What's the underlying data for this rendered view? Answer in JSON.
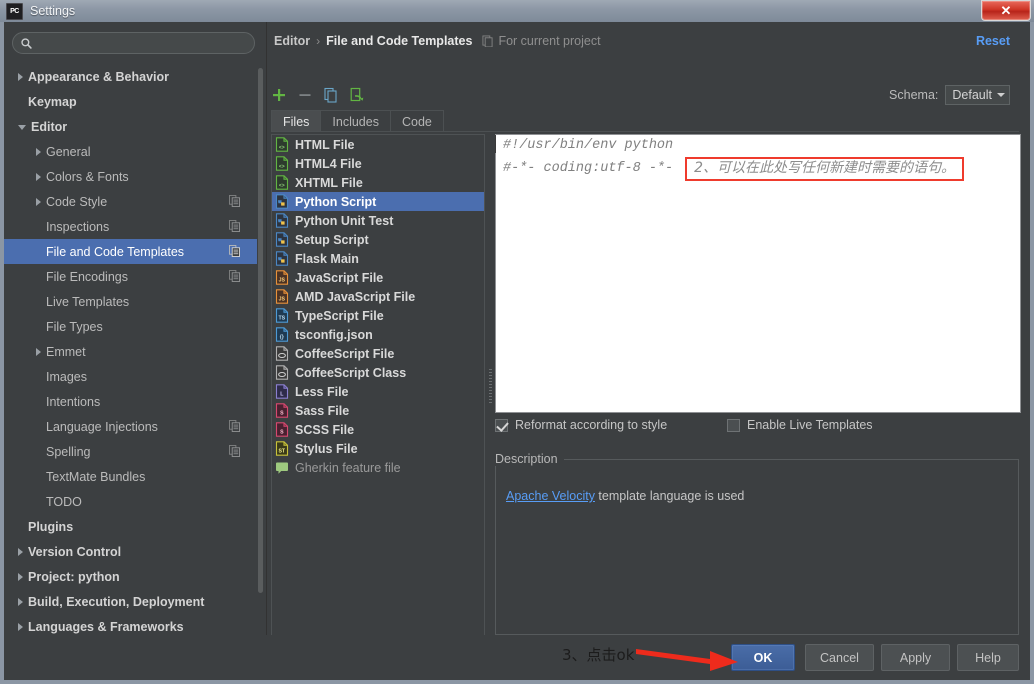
{
  "window": {
    "title": "Settings",
    "logo_text": "PC",
    "close_label": "✕"
  },
  "sidebar": {
    "search_placeholder": "",
    "search_value": "",
    "items": [
      {
        "label": "Appearance & Behavior",
        "level": 0,
        "arrow": "right",
        "bold": true,
        "selected": false,
        "badge": false
      },
      {
        "label": "Keymap",
        "level": 0,
        "arrow": "none",
        "bold": true,
        "selected": false,
        "badge": false
      },
      {
        "label": "Editor",
        "level": 0,
        "arrow": "down",
        "bold": true,
        "selected": false,
        "badge": false
      },
      {
        "label": "General",
        "level": 1,
        "arrow": "right",
        "bold": false,
        "selected": false,
        "badge": false
      },
      {
        "label": "Colors & Fonts",
        "level": 1,
        "arrow": "right",
        "bold": false,
        "selected": false,
        "badge": false
      },
      {
        "label": "Code Style",
        "level": 1,
        "arrow": "right",
        "bold": false,
        "selected": false,
        "badge": true
      },
      {
        "label": "Inspections",
        "level": 1,
        "arrow": "none",
        "bold": false,
        "selected": false,
        "badge": true
      },
      {
        "label": "File and Code Templates",
        "level": 1,
        "arrow": "none",
        "bold": false,
        "selected": true,
        "badge": true
      },
      {
        "label": "File Encodings",
        "level": 1,
        "arrow": "none",
        "bold": false,
        "selected": false,
        "badge": true
      },
      {
        "label": "Live Templates",
        "level": 1,
        "arrow": "none",
        "bold": false,
        "selected": false,
        "badge": false
      },
      {
        "label": "File Types",
        "level": 1,
        "arrow": "none",
        "bold": false,
        "selected": false,
        "badge": false
      },
      {
        "label": "Emmet",
        "level": 1,
        "arrow": "right",
        "bold": false,
        "selected": false,
        "badge": false
      },
      {
        "label": "Images",
        "level": 1,
        "arrow": "none",
        "bold": false,
        "selected": false,
        "badge": false
      },
      {
        "label": "Intentions",
        "level": 1,
        "arrow": "none",
        "bold": false,
        "selected": false,
        "badge": false
      },
      {
        "label": "Language Injections",
        "level": 1,
        "arrow": "none",
        "bold": false,
        "selected": false,
        "badge": true
      },
      {
        "label": "Spelling",
        "level": 1,
        "arrow": "none",
        "bold": false,
        "selected": false,
        "badge": true
      },
      {
        "label": "TextMate Bundles",
        "level": 1,
        "arrow": "none",
        "bold": false,
        "selected": false,
        "badge": false
      },
      {
        "label": "TODO",
        "level": 1,
        "arrow": "none",
        "bold": false,
        "selected": false,
        "badge": false
      },
      {
        "label": "Plugins",
        "level": 0,
        "arrow": "none",
        "bold": true,
        "selected": false,
        "badge": false
      },
      {
        "label": "Version Control",
        "level": 0,
        "arrow": "right",
        "bold": true,
        "selected": false,
        "badge": false
      },
      {
        "label": "Project: python",
        "level": 0,
        "arrow": "right",
        "bold": true,
        "selected": false,
        "badge": false
      },
      {
        "label": "Build, Execution, Deployment",
        "level": 0,
        "arrow": "right",
        "bold": true,
        "selected": false,
        "badge": false
      },
      {
        "label": "Languages & Frameworks",
        "level": 0,
        "arrow": "right",
        "bold": true,
        "selected": false,
        "badge": false
      }
    ]
  },
  "header": {
    "breadcrumb_parent": "Editor",
    "breadcrumb_sep": "›",
    "breadcrumb_current": "File and Code Templates",
    "project_scope": "For current project",
    "reset_label": "Reset",
    "schema_label": "Schema:",
    "schema_value": "Default"
  },
  "toolbar": {
    "add_title": "add-icon",
    "remove_title": "remove-icon",
    "copy_title": "copy-icon",
    "reset_title": "reset-template-icon"
  },
  "tabs": [
    {
      "label": "Files",
      "active": true
    },
    {
      "label": "Includes",
      "active": false
    },
    {
      "label": "Code",
      "active": false
    }
  ],
  "templates": [
    {
      "label": "HTML File",
      "icon": "html",
      "selected": false,
      "dim": false
    },
    {
      "label": "HTML4 File",
      "icon": "html",
      "selected": false,
      "dim": false
    },
    {
      "label": "XHTML File",
      "icon": "xhtml",
      "selected": false,
      "dim": false
    },
    {
      "label": "Python Script",
      "icon": "python",
      "selected": true,
      "dim": false
    },
    {
      "label": "Python Unit Test",
      "icon": "python",
      "selected": false,
      "dim": false
    },
    {
      "label": "Setup Script",
      "icon": "python",
      "selected": false,
      "dim": false
    },
    {
      "label": "Flask Main",
      "icon": "python",
      "selected": false,
      "dim": false
    },
    {
      "label": "JavaScript File",
      "icon": "js",
      "selected": false,
      "dim": false
    },
    {
      "label": "AMD JavaScript File",
      "icon": "js",
      "selected": false,
      "dim": false
    },
    {
      "label": "TypeScript File",
      "icon": "ts",
      "selected": false,
      "dim": false
    },
    {
      "label": "tsconfig.json",
      "icon": "json",
      "selected": false,
      "dim": false
    },
    {
      "label": "CoffeeScript File",
      "icon": "coffee",
      "selected": false,
      "dim": false
    },
    {
      "label": "CoffeeScript Class",
      "icon": "coffee",
      "selected": false,
      "dim": false
    },
    {
      "label": "Less File",
      "icon": "less",
      "selected": false,
      "dim": false
    },
    {
      "label": "Sass File",
      "icon": "sass",
      "selected": false,
      "dim": false
    },
    {
      "label": "SCSS File",
      "icon": "sass",
      "selected": false,
      "dim": false
    },
    {
      "label": "Stylus File",
      "icon": "stylus",
      "selected": false,
      "dim": false
    },
    {
      "label": "Gherkin feature file",
      "icon": "gherkin",
      "selected": false,
      "dim": true
    }
  ],
  "editor": {
    "line1": "#!/usr/bin/env python",
    "line2": "#-*- coding:utf-8 -*-",
    "annotation2": "2、可以在此处写任何新建时需要的语句。"
  },
  "options": {
    "reformat_label": "Reformat according to style",
    "reformat_checked": true,
    "live_templates_label": "Enable Live Templates",
    "live_templates_checked": false
  },
  "description": {
    "title": "Description",
    "link_text": "Apache Velocity",
    "rest_text": " template language is used"
  },
  "buttons": {
    "ok": "OK",
    "cancel": "Cancel",
    "apply": "Apply",
    "help": "Help"
  },
  "annotations": {
    "step3": "3、点击ok"
  },
  "colors": {
    "accent_blue": "#4b6eaf",
    "link_blue": "#589df6",
    "annotation_red": "#ef3b2d",
    "panel_bg": "#3c3f41",
    "editor_bg": "#ffffff",
    "close_red": "#cf3526"
  }
}
